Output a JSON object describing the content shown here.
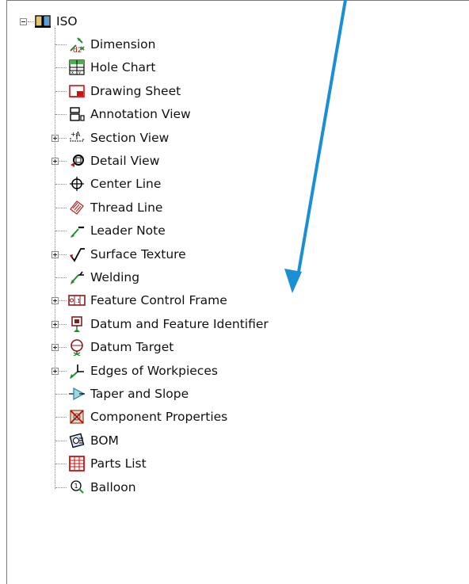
{
  "tree": {
    "root": {
      "label": "ISO",
      "icon": "book-icon",
      "expanded": true
    },
    "items": [
      {
        "label": "Dimension",
        "icon": "dimension-icon",
        "expander": null
      },
      {
        "label": "Hole Chart",
        "icon": "hole-chart-icon",
        "expander": null
      },
      {
        "label": "Drawing Sheet",
        "icon": "drawing-sheet-icon",
        "expander": null
      },
      {
        "label": "Annotation View",
        "icon": "annotation-view-icon",
        "expander": null
      },
      {
        "label": "Section View",
        "icon": "section-view-icon",
        "expander": "plus"
      },
      {
        "label": "Detail View",
        "icon": "detail-view-icon",
        "expander": "plus"
      },
      {
        "label": "Center Line",
        "icon": "center-line-icon",
        "expander": null
      },
      {
        "label": "Thread Line",
        "icon": "thread-line-icon",
        "expander": null
      },
      {
        "label": "Leader Note",
        "icon": "leader-note-icon",
        "expander": null
      },
      {
        "label": "Surface Texture",
        "icon": "surface-texture-icon",
        "expander": "plus"
      },
      {
        "label": "Welding",
        "icon": "welding-icon",
        "expander": null
      },
      {
        "label": "Feature Control Frame",
        "icon": "feature-control-frame-icon",
        "expander": "plus"
      },
      {
        "label": "Datum and Feature Identifier",
        "icon": "datum-feature-identifier-icon",
        "expander": "plus"
      },
      {
        "label": "Datum Target",
        "icon": "datum-target-icon",
        "expander": "plus"
      },
      {
        "label": "Edges of Workpieces",
        "icon": "edges-of-workpieces-icon",
        "expander": "plus"
      },
      {
        "label": "Taper and Slope",
        "icon": "taper-slope-icon",
        "expander": null
      },
      {
        "label": "Component Properties",
        "icon": "component-properties-icon",
        "expander": null
      },
      {
        "label": "BOM",
        "icon": "bom-icon",
        "expander": null
      },
      {
        "label": "Parts List",
        "icon": "parts-list-icon",
        "expander": null
      },
      {
        "label": "Balloon",
        "icon": "balloon-icon",
        "expander": null
      }
    ]
  },
  "annotation": {
    "arrow_color": "#1a8fd6"
  }
}
